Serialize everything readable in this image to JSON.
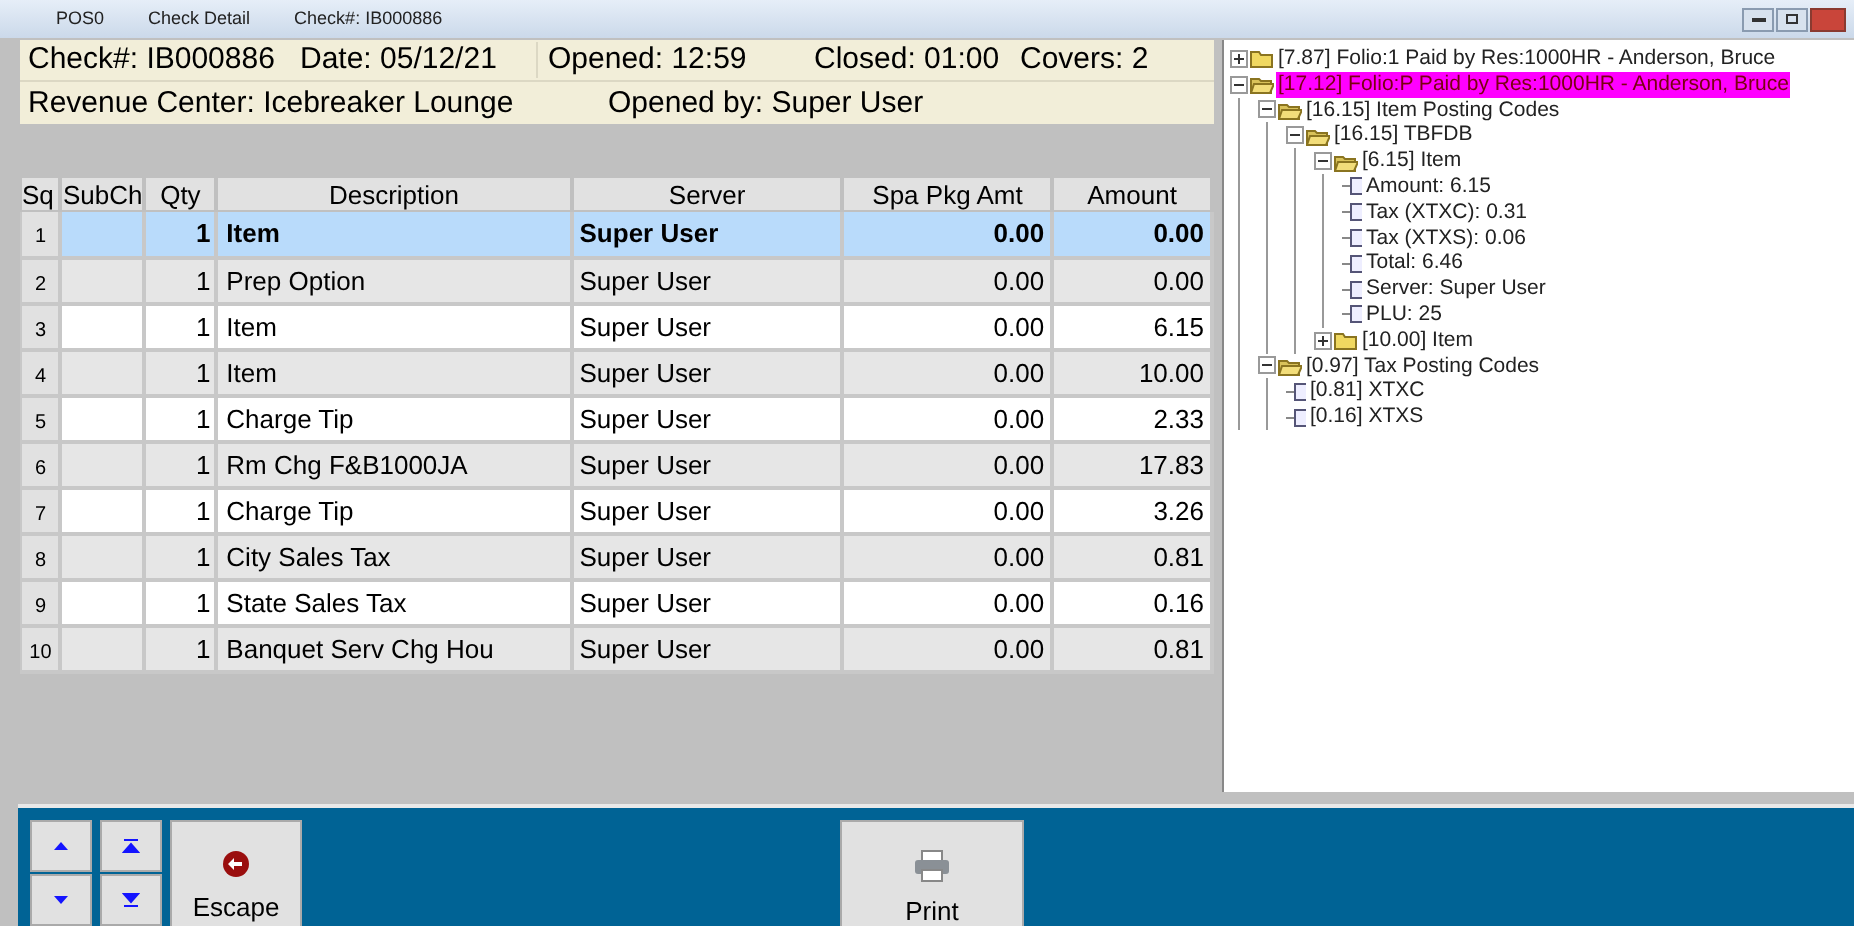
{
  "title_bar": {
    "items": [
      "POS0",
      "Check Detail",
      "Check#: IB000886"
    ]
  },
  "header": {
    "check": "Check#: IB000886",
    "date": "Date: 05/12/21",
    "opened": "Opened: 12:59",
    "closed": "Closed: 01:00",
    "covers": "Covers: 2",
    "revenue_center": "Revenue Center: Icebreaker Lounge",
    "opened_by": "Opened by: Super User"
  },
  "table": {
    "columns": [
      "Sq",
      "SubCh",
      "Qty",
      "Description",
      "Server",
      "Spa Pkg Amt",
      "Amount"
    ],
    "rows": [
      {
        "sq": "1",
        "qty": "1",
        "description": "Item",
        "server": "Super User",
        "spa": "0.00",
        "amount": "0.00",
        "selected": true
      },
      {
        "sq": "2",
        "qty": "1",
        "description": "Prep Option",
        "server": "Super User",
        "spa": "0.00",
        "amount": "0.00",
        "selected": false
      },
      {
        "sq": "3",
        "qty": "1",
        "description": "Item",
        "server": "Super User",
        "spa": "0.00",
        "amount": "6.15",
        "selected": false
      },
      {
        "sq": "4",
        "qty": "1",
        "description": "Item",
        "server": "Super User",
        "spa": "0.00",
        "amount": "10.00",
        "selected": false
      },
      {
        "sq": "5",
        "qty": "1",
        "description": "Charge Tip",
        "server": "Super User",
        "spa": "0.00",
        "amount": "2.33",
        "selected": false
      },
      {
        "sq": "6",
        "qty": "1",
        "description": "Rm Chg F&B1000JA",
        "server": "Super User",
        "spa": "0.00",
        "amount": "17.83",
        "selected": false
      },
      {
        "sq": "7",
        "qty": "1",
        "description": "Charge Tip",
        "server": "Super User",
        "spa": "0.00",
        "amount": "3.26",
        "selected": false
      },
      {
        "sq": "8",
        "qty": "1",
        "description": "City Sales Tax",
        "server": "Super User",
        "spa": "0.00",
        "amount": "0.81",
        "selected": false
      },
      {
        "sq": "9",
        "qty": "1",
        "description": "State Sales Tax",
        "server": "Super User",
        "spa": "0.00",
        "amount": "0.16",
        "selected": false
      },
      {
        "sq": "10",
        "qty": "1",
        "description": "Banquet Serv Chg Hou",
        "server": "Super User",
        "spa": "0.00",
        "amount": "0.81",
        "selected": false
      }
    ]
  },
  "tree": [
    {
      "kind": "folder",
      "label": "[7.87] Folio:1 Paid by Res:1000HR - Anderson, Bruce",
      "expanded": false,
      "selected": false
    },
    {
      "kind": "folder",
      "label": "[17.12] Folio:P Paid by Res:1000HR - Anderson, Bruce",
      "expanded": true,
      "selected": true,
      "children": [
        {
          "kind": "folder",
          "label": "[16.15] Item Posting Codes",
          "expanded": true,
          "selected": false,
          "children": [
            {
              "kind": "folder",
              "label": "[16.15] TBFDB",
              "expanded": true,
              "selected": false,
              "children": [
                {
                  "kind": "folder",
                  "label": "[6.15] Item",
                  "expanded": true,
                  "selected": false,
                  "children": [
                    {
                      "kind": "file",
                      "label": "Amount: 6.15",
                      "selected": false
                    },
                    {
                      "kind": "file",
                      "label": "Tax (XTXC): 0.31",
                      "selected": false
                    },
                    {
                      "kind": "file",
                      "label": "Tax (XTXS): 0.06",
                      "selected": false
                    },
                    {
                      "kind": "file",
                      "label": "Total: 6.46",
                      "selected": false
                    },
                    {
                      "kind": "file",
                      "label": "Server: Super User",
                      "selected": false
                    },
                    {
                      "kind": "file",
                      "label": "PLU: 25",
                      "selected": false
                    }
                  ]
                },
                {
                  "kind": "folder",
                  "label": "[10.00] Item",
                  "expanded": false,
                  "selected": false
                }
              ]
            }
          ]
        },
        {
          "kind": "folder",
          "label": "[0.97] Tax Posting Codes",
          "expanded": true,
          "selected": false,
          "children": [
            {
              "kind": "file",
              "label": "[0.81] XTXC",
              "selected": false
            },
            {
              "kind": "file",
              "label": "[0.16] XTXS",
              "selected": false
            }
          ]
        }
      ]
    }
  ],
  "buttons": [
    {
      "kind": "up"
    },
    {
      "kind": "top"
    },
    {
      "kind": "down"
    },
    {
      "kind": "bottom"
    },
    {
      "kind": "escape",
      "label": "Escape"
    },
    {
      "kind": "print",
      "label": "Print"
    }
  ]
}
